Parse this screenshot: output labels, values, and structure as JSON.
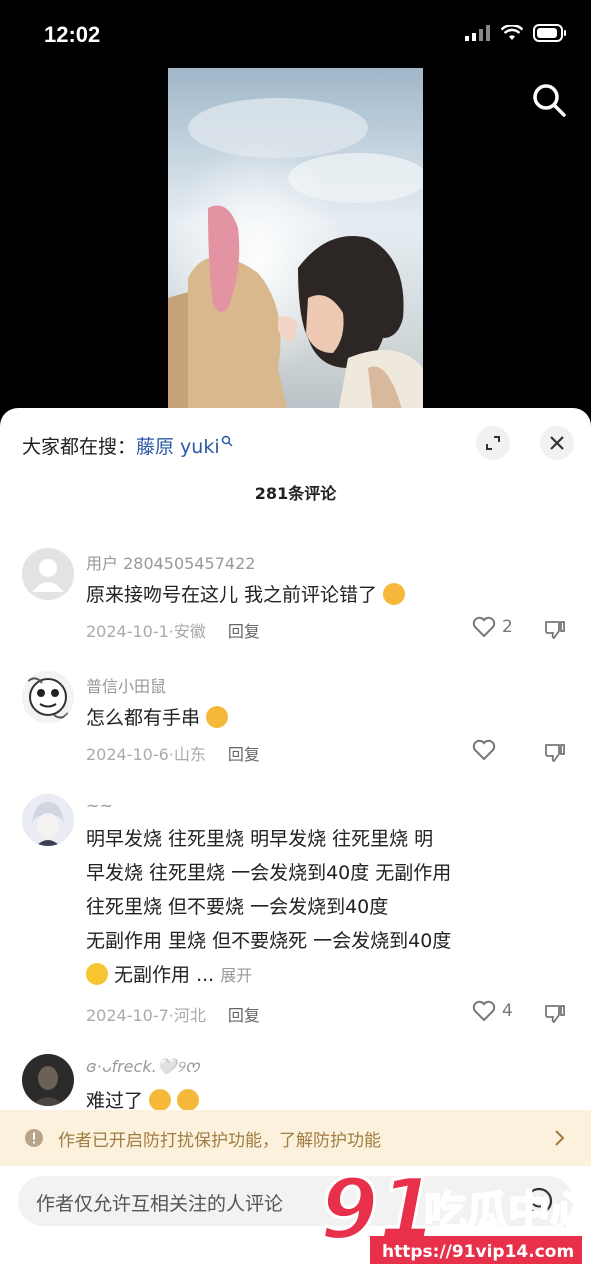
{
  "status_bar": {
    "time": "12:02"
  },
  "sheet": {
    "trending_prefix": "大家都在搜：",
    "trending_keyword": "藤原 yuki",
    "comment_count": "281条评论",
    "comments": [
      {
        "username": "用户 2804505457422",
        "text": "原来接吻号在这儿 我之前评论错了",
        "meta": "2024-10-1·安徽",
        "reply": "回复",
        "likes": "2"
      },
      {
        "username": "普信小田鼠",
        "text": "怎么都有手串",
        "meta": "2024-10-6·山东",
        "reply": "回复",
        "likes": ""
      },
      {
        "username": "~~",
        "text_lines": [
          "明早发烧 往死里烧 明早发烧 往死里烧 明",
          "早发烧 往死里烧  一会发烧到40度 无副作用",
          "往死里烧 但不要烧  一会发烧到40度",
          "无副作用 里烧 但不要烧死 一会发烧到40度",
          "无副作用 ..."
        ],
        "expand": "展开",
        "meta": "2024-10-7·河北",
        "reply": "回复",
        "likes": "4"
      },
      {
        "username": "ɞ·ᴗfreck.🤍୨ᰔ",
        "text": "难过了"
      }
    ],
    "notice": "作者已开启防打扰保护功能，了解防护功能",
    "input_placeholder": "作者仅允许互相关注的人评论"
  },
  "watermark": {
    "brand": "91吃瓜中心",
    "url": "https://91vip14.com"
  }
}
